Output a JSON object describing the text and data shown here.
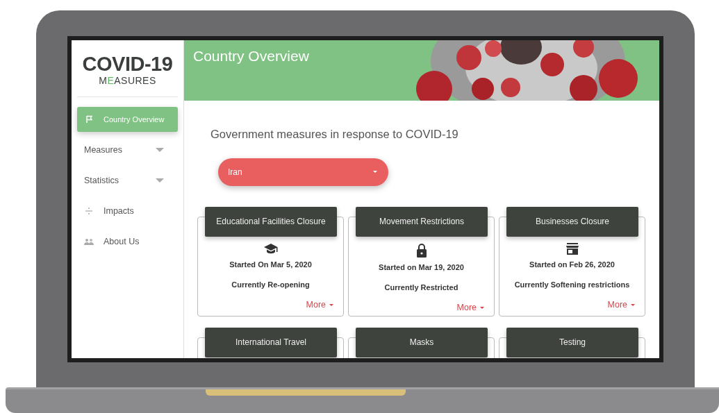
{
  "logo": {
    "title": "COVID-19",
    "subtitle_parts": [
      {
        "text": "M",
        "highlight": false
      },
      {
        "text": "E",
        "highlight": true
      },
      {
        "text": "ASURES",
        "highlight": false
      }
    ]
  },
  "sidebar": {
    "items": [
      {
        "label": "Country Overview",
        "kind": "link",
        "selected": true
      },
      {
        "label": "Measures",
        "kind": "dropdown",
        "selected": false
      },
      {
        "label": "Statistics",
        "kind": "dropdown",
        "selected": false
      },
      {
        "label": "Impacts",
        "kind": "link",
        "selected": false
      },
      {
        "label": "About Us",
        "kind": "link",
        "selected": false
      }
    ]
  },
  "header": {
    "title": "Country Overview"
  },
  "heading": "Government measures in response to COVID-19",
  "country_select": {
    "value": "Iran"
  },
  "cards": [
    {
      "title": "Educational Facilities Closure",
      "started": "Started On Mar 5, 2020",
      "status": "Currently Re-opening",
      "more": "More"
    },
    {
      "title": "Movement Restrictions",
      "started": "Started on Mar 19, 2020",
      "status": "Currently Restricted",
      "more": "More"
    },
    {
      "title": "Businesses Closure",
      "started": "Started on Feb 26, 2020",
      "status": "Currently Softening restrictions",
      "more": "More"
    },
    {
      "title": "International Travel"
    },
    {
      "title": "Masks"
    },
    {
      "title": "Testing"
    }
  ]
}
